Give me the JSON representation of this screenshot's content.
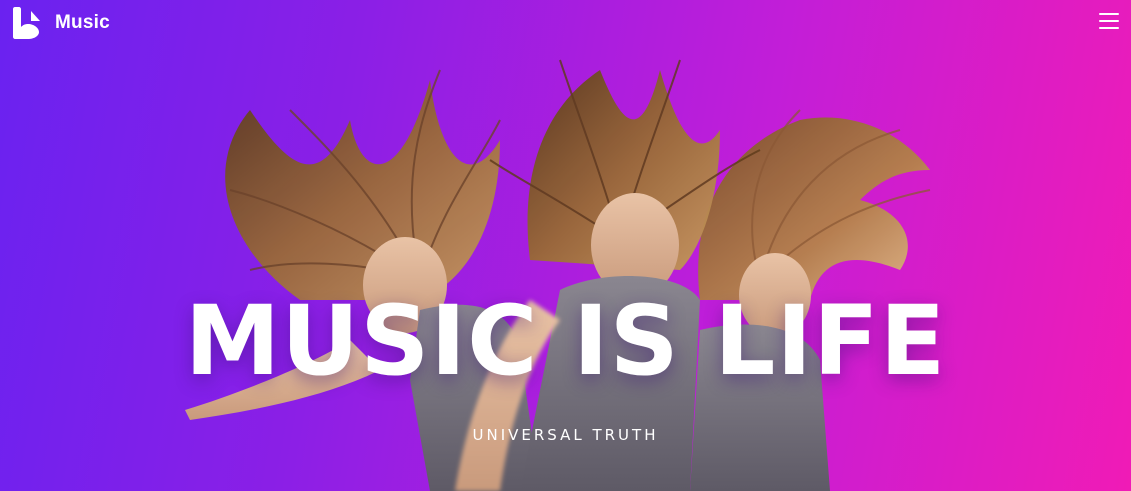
{
  "navbar": {
    "brand_name": "Music",
    "logo_icon": "music-logo-icon",
    "menu_icon": "hamburger-menu-icon"
  },
  "hero": {
    "headline": "MUSIC IS LIFE",
    "tagline": "UNIVERSAL TRUTH",
    "image": "three women dancing with flying hair"
  },
  "colors": {
    "gradient_start": "#6a22f0",
    "gradient_end": "#f01bb6",
    "text": "#ffffff"
  }
}
